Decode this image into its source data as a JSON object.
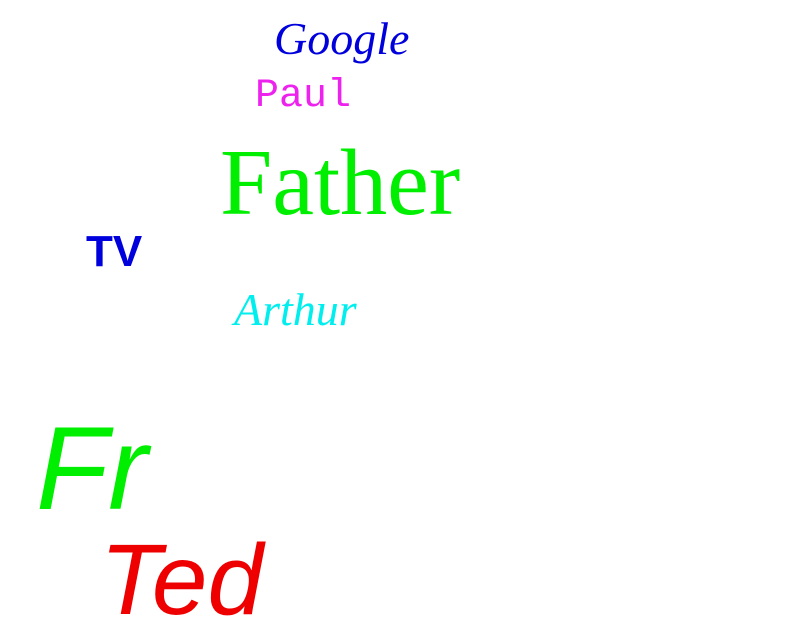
{
  "words": {
    "google": {
      "text": "Google",
      "color": "#0000dd"
    },
    "paul": {
      "text": "Paul",
      "color": "#ee22ee"
    },
    "father": {
      "text": "Father",
      "color": "#00ee00"
    },
    "tv": {
      "text": "TV",
      "color": "#0000dd"
    },
    "arthur": {
      "text": "Arthur",
      "color": "#00eeee"
    },
    "fr": {
      "text": "Fr",
      "color": "#00ee00"
    },
    "ted": {
      "text": "Ted",
      "color": "#ee0000"
    }
  }
}
